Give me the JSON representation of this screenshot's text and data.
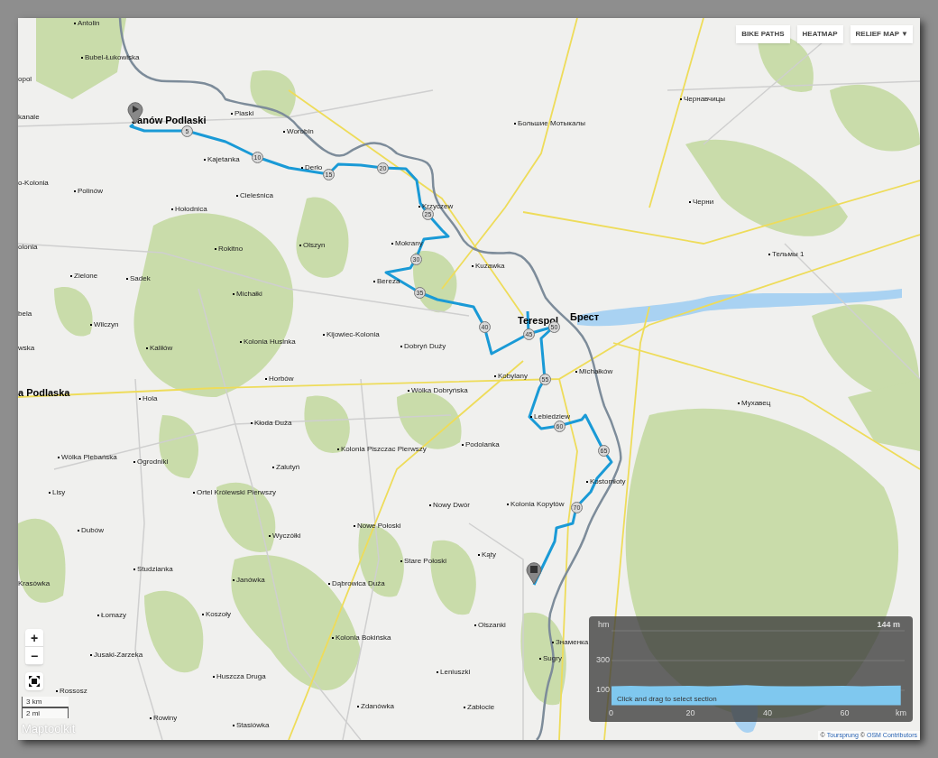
{
  "layer_buttons": [
    {
      "label": "BIKE PATHS",
      "kind": "plain"
    },
    {
      "label": "HEATMAP",
      "kind": "plain"
    },
    {
      "label": "RELIEF MAP ▼",
      "kind": "menu"
    }
  ],
  "places": [
    {
      "text": "Antolin",
      "kind": "village"
    },
    {
      "text": "Bubel-Łukowiska",
      "kind": "village"
    },
    {
      "text": "opol",
      "kind": "cut"
    },
    {
      "text": "Чернавчицы",
      "kind": "village"
    },
    {
      "text": "kanale",
      "kind": "cut"
    },
    {
      "text": "Janów Podlaski",
      "kind": "town"
    },
    {
      "text": "Piaski",
      "kind": "village"
    },
    {
      "text": "Большие Мотыкалы",
      "kind": "village"
    },
    {
      "text": "Worobin",
      "kind": "village"
    },
    {
      "text": "Kajetanka",
      "kind": "village"
    },
    {
      "text": "Derło",
      "kind": "village"
    },
    {
      "text": "o-Kolonia",
      "kind": "cut"
    },
    {
      "text": "Polinów",
      "kind": "village"
    },
    {
      "text": "Cieleśnica",
      "kind": "village"
    },
    {
      "text": "Hołodnica",
      "kind": "village"
    },
    {
      "text": "Krzyczew",
      "kind": "village"
    },
    {
      "text": "Черни",
      "kind": "village"
    },
    {
      "text": "olonia",
      "kind": "cut"
    },
    {
      "text": "Rokitno",
      "kind": "village"
    },
    {
      "text": "Olszyn",
      "kind": "village"
    },
    {
      "text": "Mokrany",
      "kind": "village"
    },
    {
      "text": "Тельмы 1",
      "kind": "village"
    },
    {
      "text": "Kuzawka",
      "kind": "village"
    },
    {
      "text": "Zielone",
      "kind": "village"
    },
    {
      "text": "Sadek",
      "kind": "village"
    },
    {
      "text": "Bereza",
      "kind": "village"
    },
    {
      "text": "Michałki",
      "kind": "village"
    },
    {
      "text": "bela",
      "kind": "cut"
    },
    {
      "text": "Wilczyn",
      "kind": "village"
    },
    {
      "text": "Terespol",
      "kind": "town"
    },
    {
      "text": "Брест",
      "kind": "town"
    },
    {
      "text": "wska",
      "kind": "cut"
    },
    {
      "text": "Kaliłów",
      "kind": "village"
    },
    {
      "text": "Kolonia Husinka",
      "kind": "village"
    },
    {
      "text": "Kijowiec-Kolonia",
      "kind": "village"
    },
    {
      "text": "Dobryń Duży",
      "kind": "village"
    },
    {
      "text": "Horbów",
      "kind": "village"
    },
    {
      "text": "Kobylany",
      "kind": "village"
    },
    {
      "text": "Michałków",
      "kind": "village"
    },
    {
      "text": "a Podlaska",
      "kind": "town"
    },
    {
      "text": "Hola",
      "kind": "village"
    },
    {
      "text": "Wólka Dobryńska",
      "kind": "village"
    },
    {
      "text": "Мухавец",
      "kind": "village"
    },
    {
      "text": "Kłoda Duża",
      "kind": "village"
    },
    {
      "text": "Lebiedziew",
      "kind": "village"
    },
    {
      "text": "Kolonia Piszczac Pierwszy",
      "kind": "village"
    },
    {
      "text": "Podolanka",
      "kind": "village"
    },
    {
      "text": "Wólka Plebańska",
      "kind": "village"
    },
    {
      "text": "Ogrodniki",
      "kind": "village"
    },
    {
      "text": "Zalutyń",
      "kind": "village"
    },
    {
      "text": "Kostomłoty",
      "kind": "village"
    },
    {
      "text": "Lisy",
      "kind": "village"
    },
    {
      "text": "Ortel Królewski Pierwszy",
      "kind": "village"
    },
    {
      "text": "Nowy Dwór",
      "kind": "village"
    },
    {
      "text": "Kolonia Kopytów",
      "kind": "village"
    },
    {
      "text": "Dubów",
      "kind": "village"
    },
    {
      "text": "Wyczółki",
      "kind": "village"
    },
    {
      "text": "Nowe Połoski",
      "kind": "village"
    },
    {
      "text": "Stare Połoski",
      "kind": "village"
    },
    {
      "text": "Kąty",
      "kind": "village"
    },
    {
      "text": "Studzianka",
      "kind": "village"
    },
    {
      "text": "Krasówka",
      "kind": "cut"
    },
    {
      "text": "Janówka",
      "kind": "village"
    },
    {
      "text": "Dąbrowica Duża",
      "kind": "village"
    },
    {
      "text": "Łomazy",
      "kind": "village"
    },
    {
      "text": "Koszoły",
      "kind": "village"
    },
    {
      "text": "Olszanki",
      "kind": "village"
    },
    {
      "text": "Kolonia Bokińska",
      "kind": "village"
    },
    {
      "text": "Знаменка",
      "kind": "village"
    },
    {
      "text": "Jusaki-Zarzeka",
      "kind": "village"
    },
    {
      "text": "Sugry",
      "kind": "village"
    },
    {
      "text": "Huszcza Druga",
      "kind": "village"
    },
    {
      "text": "Leniuszki",
      "kind": "village"
    },
    {
      "text": "Rossosz",
      "kind": "village"
    },
    {
      "text": "Zdanówka",
      "kind": "village"
    },
    {
      "text": "Zabłocie",
      "kind": "village"
    },
    {
      "text": "Rowiny",
      "kind": "village"
    },
    {
      "text": "Stasiówka",
      "kind": "village"
    }
  ],
  "distance_markers": [
    "5",
    "10",
    "15",
    "20",
    "25",
    "30",
    "35",
    "40",
    "45",
    "50",
    "55",
    "60",
    "65",
    "70"
  ],
  "zoom_controls": [
    "+",
    "−"
  ],
  "scale": [
    "3 km",
    "2 mi"
  ],
  "elevation": {
    "max_label": "144 m",
    "hint": "Click and drag to select section",
    "chart_data": {
      "type": "area",
      "xlabel": "km",
      "ylabel": "hm",
      "x": [
        0,
        5,
        10,
        15,
        20,
        25,
        30,
        35,
        40,
        45,
        50,
        55,
        60,
        65,
        70,
        75
      ],
      "series": [
        {
          "color": "#7fc8ef",
          "values": [
            128,
            130,
            127,
            129,
            131,
            128,
            130,
            135,
            129,
            127,
            128,
            129,
            130,
            128,
            131,
            132
          ]
        }
      ],
      "xlim": [
        0,
        76
      ],
      "ylim": [
        0,
        500
      ],
      "xticks": [
        0,
        20,
        40,
        60
      ],
      "yticks": [
        100,
        300
      ]
    }
  },
  "logo": "Maptoolkit",
  "attribution": [
    {
      "kind": "sep",
      "text": "©"
    },
    {
      "kind": "link",
      "text": "Toursprung"
    },
    {
      "kind": "sep",
      "text": "©"
    },
    {
      "kind": "link",
      "text": "OSM Contributors"
    }
  ]
}
